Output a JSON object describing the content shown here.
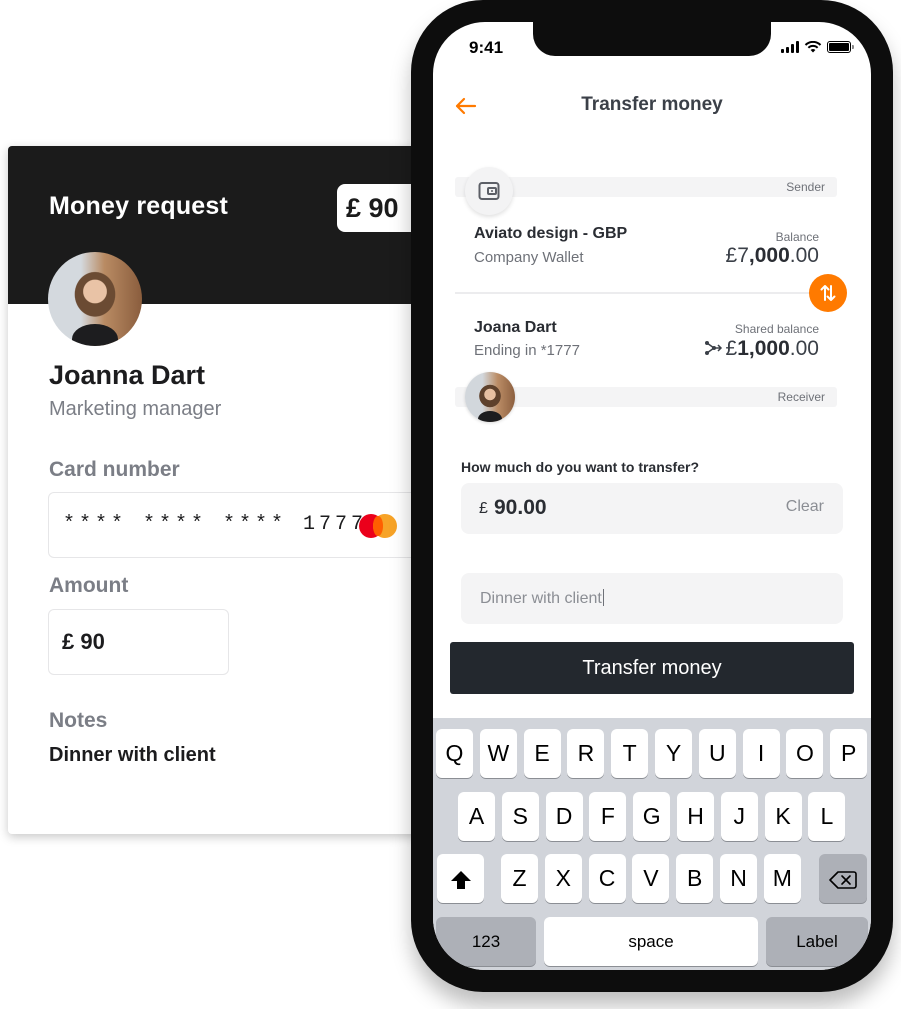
{
  "request_card": {
    "title": "Money request",
    "amount_badge": "£ 90",
    "person": {
      "name": "Joanna Dart",
      "role": "Marketing manager"
    },
    "card_number_label": "Card number",
    "card_number": "**** **** **** 1777",
    "card_brand_icon": "mastercard-icon",
    "amount_label": "Amount",
    "amount_value": "£ 90",
    "notes_label": "Notes",
    "notes_value": "Dinner with client"
  },
  "phone": {
    "status_bar": {
      "time": "9:41",
      "icons": [
        "signal-icon",
        "wifi-icon",
        "battery-icon"
      ]
    },
    "header": {
      "back_icon": "arrow-left-icon",
      "title": "Transfer money"
    },
    "sender": {
      "tag": "Sender",
      "icon": "wallet-icon",
      "name": "Aviato design - GBP",
      "subtitle": "Company Wallet",
      "balance_label": "Balance",
      "balance_currency": "£",
      "balance_prefix": "7",
      "balance_main": ",000",
      "balance_decimals": ".00"
    },
    "swap_icon": "swap-vertical-icon",
    "receiver": {
      "tag": "Receiver",
      "name": "Joana Dart",
      "subtitle": "Ending in *1777",
      "balance_label": "Shared balance",
      "share_icon": "share-nodes-icon",
      "balance_currency": "£",
      "balance_main": "1,000",
      "balance_decimals": ".00"
    },
    "transfer_question": "How much do you want to transfer?",
    "amount_input": {
      "currency": "£",
      "value": "90.00",
      "clear_label": "Clear"
    },
    "note_input": {
      "value": "Dinner with client"
    },
    "transfer_button": "Transfer money",
    "keyboard": {
      "row1": [
        "Q",
        "W",
        "E",
        "R",
        "T",
        "Y",
        "U",
        "I",
        "O",
        "P"
      ],
      "row2": [
        "A",
        "S",
        "D",
        "F",
        "G",
        "H",
        "J",
        "K",
        "L"
      ],
      "row3": [
        "Z",
        "X",
        "C",
        "V",
        "B",
        "N",
        "M"
      ],
      "shift_icon": "shift-icon",
      "backspace_icon": "backspace-icon",
      "numbers_key": "123",
      "space_key": "space",
      "return_key": "Label"
    }
  },
  "colors": {
    "accent": "#ff7a00",
    "dark_header": "#1b1b1b",
    "button_dark": "#23282e"
  }
}
